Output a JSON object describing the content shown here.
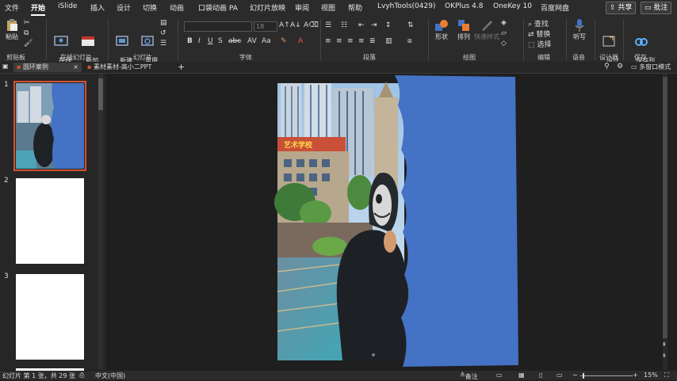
{
  "menu": {
    "tabs": [
      "文件",
      "开始",
      "iSlide",
      "插入",
      "设计",
      "切换",
      "动画",
      "口袋动画 PA",
      "幻灯片放映",
      "审阅",
      "视图",
      "帮助",
      "LvyhTools(0429)",
      "OKPlus 4.8",
      "OneKey 10",
      "百度网盘"
    ],
    "active_tab": "开始",
    "share": "共享",
    "comment": "批注"
  },
  "ribbon": {
    "paste": "粘贴",
    "clipboard_group": "剪贴板",
    "present_online": "在线\n幻灯片",
    "new_online": "新加\n载项",
    "online_group": "在线幻灯片",
    "new_slide": "新建\n幻灯片",
    "reuse_slide": "重用\n幻灯片",
    "slides_group": "幻灯片",
    "font_size": "18",
    "font_group": "字体",
    "paragraph_group": "段落",
    "shape": "形状",
    "arrange": "排列",
    "quick_styles": "快速样式",
    "drawing_group": "绘图",
    "find": "查找",
    "replace": "替换",
    "select": "选择",
    "editing_group": "编辑",
    "dictate": "听写",
    "voice_group": "语音",
    "designer_ideas": "设计\n灵感",
    "designer_group": "设计器",
    "save_to_baidu": "保存到\n百度网盘",
    "save_group": "保存"
  },
  "doc_tabs": [
    {
      "label": "圆环案例",
      "active": true
    },
    {
      "label": "素材素材-高小二PPT",
      "active": false
    }
  ],
  "doc_tab_right": "多窗口模式",
  "thumbnails": [
    {
      "num": "1",
      "selected": true
    },
    {
      "num": "2",
      "selected": false
    },
    {
      "num": "3",
      "selected": false
    }
  ],
  "status": {
    "slide_info": "幻灯片 第 1 张，共 29 张",
    "language": "中文(中国)",
    "notes": "备注",
    "zoom": "15%"
  },
  "colors": {
    "blue_panel": "#4472c4",
    "accent": "#d35230"
  }
}
